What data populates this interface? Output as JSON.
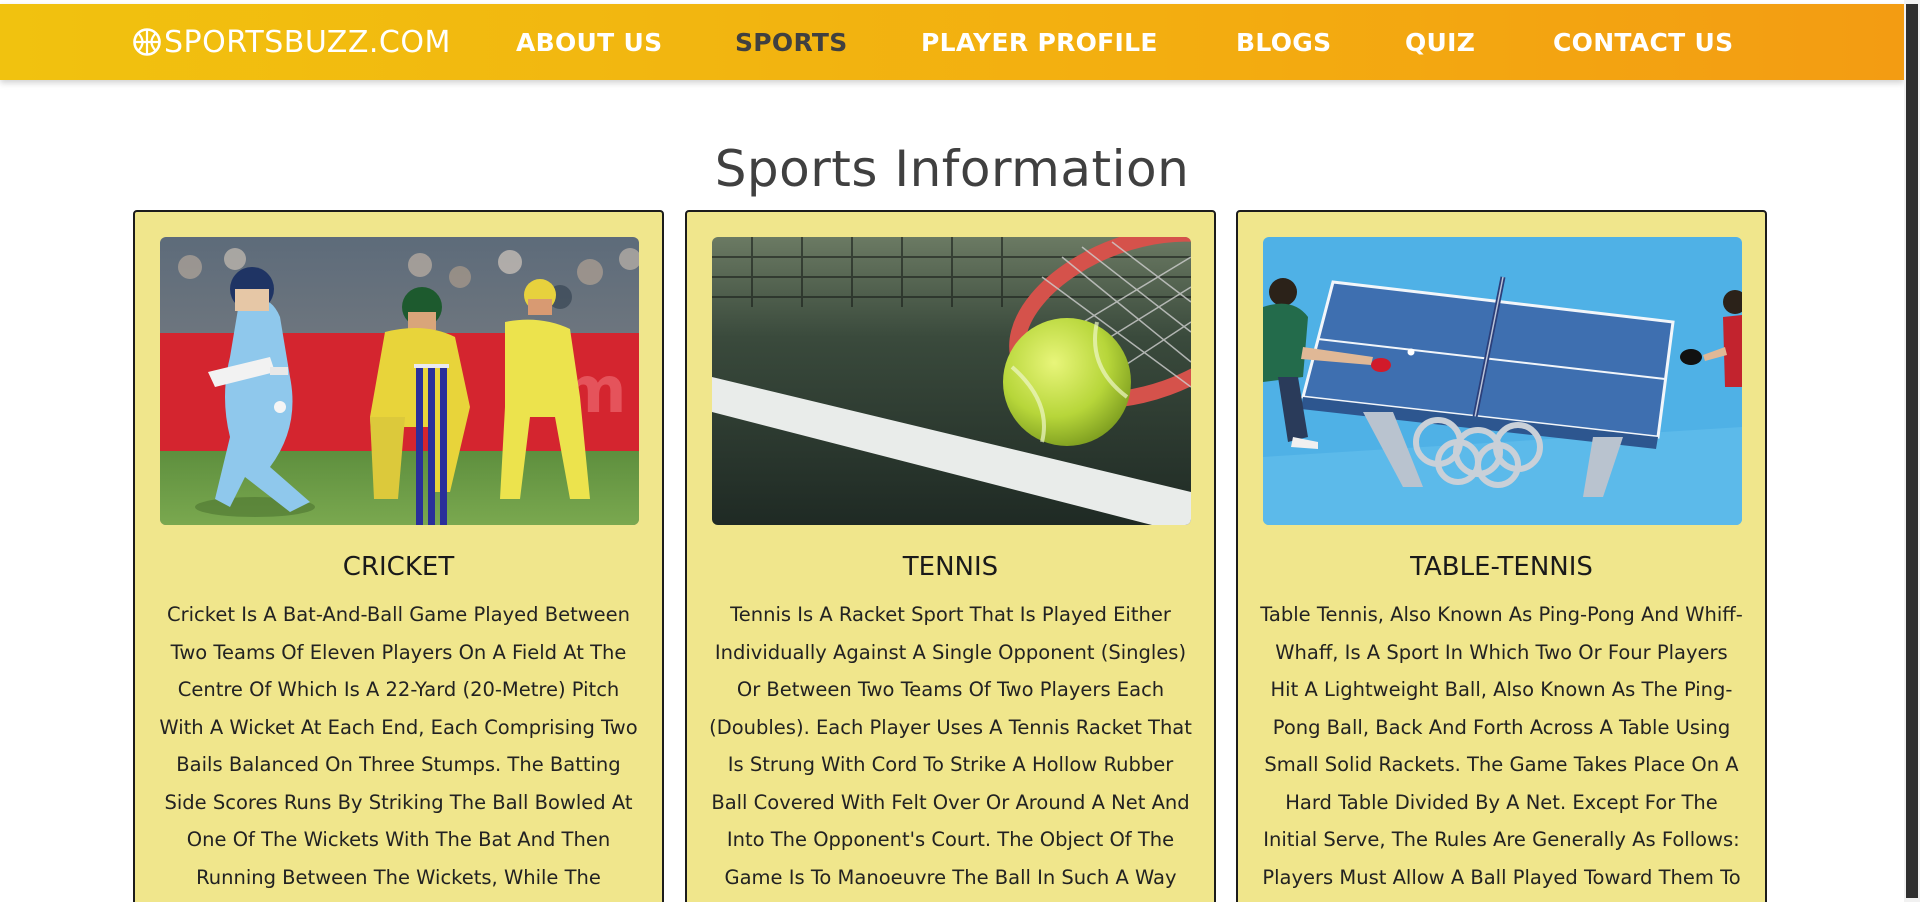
{
  "brand": {
    "name": "SPORTSBUZZ.COM",
    "icon": "basketball-icon"
  },
  "nav": {
    "items": [
      {
        "label": "ABOUT US"
      },
      {
        "label": "SPORTS",
        "active": true
      },
      {
        "label": "PLAYER PROFILE"
      },
      {
        "label": "BLOGS"
      },
      {
        "label": "QUIZ"
      },
      {
        "label": "CONTACT US"
      }
    ]
  },
  "page": {
    "title": "Sports Information"
  },
  "cards": [
    {
      "title": "CRICKET",
      "image": "cricket-photo",
      "text": "Cricket Is A Bat-And-Ball Game Played Between Two Teams Of Eleven Players On A Field At The Centre Of Which Is A 22-Yard (20-Metre) Pitch With A Wicket At Each End, Each Comprising Two Bails Balanced On Three Stumps. The Batting Side Scores Runs By Striking The Ball Bowled At One Of The Wickets With The Bat And Then Running Between The Wickets, While The Bowling And"
    },
    {
      "title": "TENNIS",
      "image": "tennis-photo",
      "text": "Tennis Is A Racket Sport That Is Played Either Individually Against A Single Opponent (Singles) Or Between Two Teams Of Two Players Each (Doubles). Each Player Uses A Tennis Racket That Is Strung With Cord To Strike A Hollow Rubber Ball Covered With Felt Over Or Around A Net And Into The Opponent's Court. The Object Of The Game Is To Manoeuvre The Ball In Such A Way"
    },
    {
      "title": "TABLE-TENNIS",
      "image": "table-tennis-photo",
      "text": "Table Tennis, Also Known As Ping-Pong And Whiff-Whaff, Is A Sport In Which Two Or Four Players Hit A Lightweight Ball, Also Known As The Ping-Pong Ball, Back And Forth Across A Table Using Small Solid Rackets. The Game Takes Place On A Hard Table Divided By A Net. Except For The Initial Serve, The Rules Are Generally As Follows: Players Must Allow A Ball Played Toward Them To"
    }
  ],
  "colors": {
    "navbar_start": "#f1c20f",
    "navbar_end": "#f39c12",
    "card_background": "#f0e68c",
    "active_nav": "#404040"
  }
}
